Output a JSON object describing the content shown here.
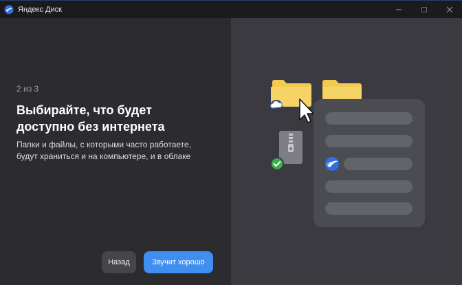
{
  "window": {
    "title": "Яндекс Диск",
    "controls": [
      "minimize",
      "maximize",
      "close"
    ]
  },
  "onboarding": {
    "step": "2 из 3",
    "heading_lines": [
      "Выбирайте, что будет",
      "доступно без интернета"
    ],
    "description_lines": [
      "Папки и файлы, с которыми часто работаете,",
      "будут храниться и на компьютере, и в облаке"
    ]
  },
  "buttons": {
    "back": "Назад",
    "confirm": "Звучит хорошо"
  },
  "illustration": {
    "icons": [
      "folder-icon",
      "folder-icon",
      "cloud-icon",
      "cursor-icon",
      "zip-archive-icon",
      "check-icon",
      "yandex-disk-icon"
    ],
    "list_rows": 5
  },
  "colors": {
    "accent": "#3f8ef0",
    "folder": "#f3c94f",
    "check": "#3cae4a",
    "left_bg": "#2b2b30",
    "right_bg": "#3a3a40"
  }
}
